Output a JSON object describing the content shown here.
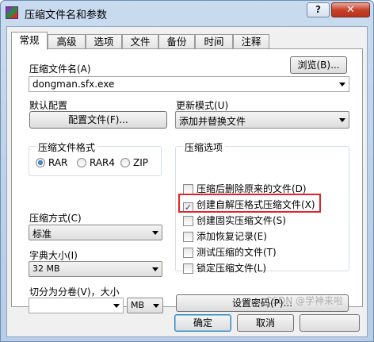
{
  "window": {
    "title": "压缩文件名和参数",
    "help_label": "?",
    "close_label": "✕"
  },
  "tabs": [
    {
      "label": "常规"
    },
    {
      "label": "高级"
    },
    {
      "label": "选项"
    },
    {
      "label": "文件"
    },
    {
      "label": "备份"
    },
    {
      "label": "时间"
    },
    {
      "label": "注释"
    }
  ],
  "archive_name": {
    "label": "压缩文件名(A)",
    "value": "dongman.sfx.exe",
    "browse_label": "浏览(B)..."
  },
  "default_profile": {
    "label": "默认配置",
    "button_label": "配置文件(F)..."
  },
  "update_mode": {
    "label": "更新模式(U)",
    "value": "添加并替换文件"
  },
  "archive_format": {
    "title": "压缩文件格式",
    "options": [
      {
        "label": "RAR",
        "selected": true
      },
      {
        "label": "RAR4",
        "selected": false
      },
      {
        "label": "ZIP",
        "selected": false
      }
    ]
  },
  "compression_method": {
    "label": "压缩方式(C)",
    "value": "标准"
  },
  "dictionary_size": {
    "label": "字典大小(I)",
    "value": "32 MB"
  },
  "split_volumes": {
    "label": "切分为分卷(V)，大小",
    "value": "",
    "unit": "MB"
  },
  "archive_options": {
    "title": "压缩选项",
    "items": [
      {
        "label": "压缩后删除原来的文件(D)",
        "checked": false
      },
      {
        "label": "创建自解压格式压缩文件(X)",
        "checked": true
      },
      {
        "label": "创建固实压缩文件(S)",
        "checked": false
      },
      {
        "label": "添加恢复记录(E)",
        "checked": false
      },
      {
        "label": "测试压缩的文件(T)",
        "checked": false
      },
      {
        "label": "锁定压缩文件(L)",
        "checked": false
      }
    ]
  },
  "set_password": {
    "label": "设置密码(P)..."
  },
  "footer": {
    "ok_label": "确定",
    "cancel_label": "取消"
  },
  "watermark": "CSDN @学神来啦",
  "colors": {
    "highlight": "#e2222c",
    "title_bar": "#bcd0e8",
    "close_button": "#c7422b"
  }
}
